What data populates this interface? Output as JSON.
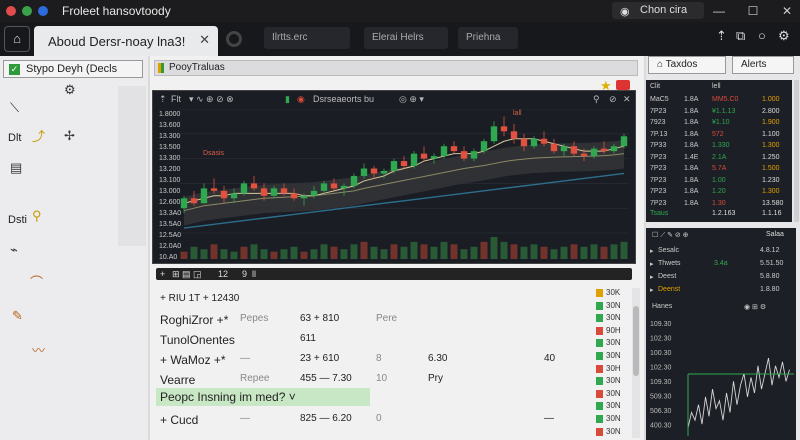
{
  "titlebar": {
    "title": "Froleet hansovtoody",
    "account": "Chon cira",
    "dot_colors": [
      "#e04b4b",
      "#3aa14a",
      "#2d6cdf"
    ]
  },
  "tabbar": {
    "active_tab": "Aboud Dersr-noay lna3!",
    "pills": [
      "Ilrtts.erc",
      "Elerai Helrs",
      "Priehna"
    ]
  },
  "sidebar": {
    "header": "Stypo Deyh (Decls",
    "labels": [
      "Dlt",
      "Dsti"
    ]
  },
  "main": {
    "header": "PooyTraluas",
    "chart_toolbar": {
      "left": "Flt",
      "indicator": "Dsrseaeorts bu"
    },
    "bottom_bar": {
      "zoom": "12",
      "pages": "9"
    }
  },
  "chart_data": {
    "type": "candlestick",
    "title": "",
    "price_labels": [
      "1.8000",
      "13.600",
      "13.300",
      "13.500",
      "13.300",
      "13.200",
      "13.100",
      "13.000",
      "12.600",
      "13.3A0",
      "13.5A0",
      "12.5A0",
      "12.0A0",
      "10.A0"
    ],
    "annotations": [
      "Dsasis",
      "lall"
    ],
    "candles": [
      [
        11.4,
        11.9,
        11.2,
        11.8
      ],
      [
        11.8,
        12.1,
        11.5,
        11.6
      ],
      [
        11.6,
        12.4,
        11.6,
        12.2
      ],
      [
        12.2,
        12.6,
        12.0,
        12.1
      ],
      [
        12.1,
        12.3,
        11.6,
        11.8
      ],
      [
        11.8,
        12.2,
        11.6,
        12.0
      ],
      [
        12.0,
        12.5,
        11.9,
        12.4
      ],
      [
        12.4,
        12.7,
        12.1,
        12.2
      ],
      [
        12.2,
        12.4,
        11.7,
        11.9
      ],
      [
        11.9,
        12.3,
        11.8,
        12.2
      ],
      [
        12.2,
        12.4,
        11.9,
        12.0
      ],
      [
        12.0,
        12.2,
        11.7,
        11.8
      ],
      [
        11.8,
        12.0,
        11.5,
        11.9
      ],
      [
        11.9,
        12.3,
        11.8,
        12.1
      ],
      [
        12.1,
        12.5,
        12.0,
        12.4
      ],
      [
        12.4,
        12.6,
        12.1,
        12.2
      ],
      [
        12.2,
        12.4,
        11.9,
        12.3
      ],
      [
        12.3,
        12.8,
        12.2,
        12.7
      ],
      [
        12.7,
        13.2,
        12.6,
        13.0
      ],
      [
        13.0,
        13.1,
        12.6,
        12.8
      ],
      [
        12.8,
        13.0,
        12.6,
        12.9
      ],
      [
        12.9,
        13.4,
        12.8,
        13.3
      ],
      [
        13.3,
        13.5,
        13.0,
        13.1
      ],
      [
        13.1,
        13.7,
        13.0,
        13.6
      ],
      [
        13.6,
        13.9,
        13.3,
        13.4
      ],
      [
        13.4,
        13.6,
        13.2,
        13.5
      ],
      [
        13.5,
        14.0,
        13.4,
        13.9
      ],
      [
        13.9,
        14.1,
        13.6,
        13.7
      ],
      [
        13.7,
        13.9,
        13.3,
        13.4
      ],
      [
        13.4,
        13.8,
        13.3,
        13.7
      ],
      [
        13.7,
        14.2,
        13.6,
        14.1
      ],
      [
        14.1,
        14.9,
        14.0,
        14.7
      ],
      [
        14.7,
        15.1,
        14.3,
        14.5
      ],
      [
        14.5,
        14.8,
        14.0,
        14.2
      ],
      [
        14.2,
        14.4,
        13.7,
        13.9
      ],
      [
        13.9,
        14.3,
        13.8,
        14.2
      ],
      [
        14.2,
        14.5,
        13.9,
        14.0
      ],
      [
        14.0,
        14.2,
        13.6,
        13.7
      ],
      [
        13.7,
        14.0,
        13.5,
        13.9
      ],
      [
        13.9,
        14.1,
        13.5,
        13.6
      ],
      [
        13.6,
        13.8,
        13.3,
        13.5
      ],
      [
        13.5,
        13.9,
        13.4,
        13.8
      ],
      [
        13.8,
        14.1,
        13.6,
        13.7
      ],
      [
        13.7,
        14.0,
        13.6,
        13.9
      ],
      [
        13.9,
        14.4,
        13.8,
        14.3
      ]
    ],
    "ma_fast": [
      11.6,
      11.7,
      11.8,
      11.9,
      11.9,
      12.0,
      12.0,
      12.0,
      12.0,
      12.0,
      12.0,
      12.0,
      11.9,
      11.9,
      12.0,
      12.1,
      12.2,
      12.3,
      12.5,
      12.6,
      12.7,
      12.9,
      13.0,
      13.1,
      13.3,
      13.4,
      13.5,
      13.6,
      13.6,
      13.6,
      13.7,
      13.9,
      14.1,
      14.2,
      14.2,
      14.2,
      14.1,
      14.0,
      13.9,
      13.8,
      13.7,
      13.7,
      13.7,
      13.8,
      13.9
    ],
    "ma_slow": [
      11.3,
      11.4,
      11.5,
      11.55,
      11.6,
      11.65,
      11.7,
      11.75,
      11.8,
      11.82,
      11.84,
      11.86,
      11.88,
      11.9,
      11.95,
      12.0,
      12.05,
      12.1,
      12.2,
      12.28,
      12.36,
      12.44,
      12.52,
      12.6,
      12.68,
      12.76,
      12.84,
      12.92,
      13.0,
      13.06,
      13.12,
      13.2,
      13.28,
      13.34,
      13.38,
      13.42,
      13.44,
      13.46,
      13.47,
      13.48,
      13.49,
      13.5,
      13.52,
      13.55,
      13.6
    ],
    "trend_line": [
      10.6,
      10.65,
      10.7,
      10.75,
      10.8,
      10.85,
      10.9,
      10.95,
      11.0,
      11.05,
      11.1,
      11.15,
      11.2,
      11.25,
      11.3,
      11.35,
      11.4,
      11.45,
      11.5,
      11.55,
      11.6,
      11.65,
      11.7,
      11.75,
      11.8,
      11.85,
      11.9,
      11.95,
      12.0,
      12.05,
      12.1,
      12.15,
      12.2,
      12.25,
      12.3,
      12.35,
      12.4,
      12.45,
      12.5,
      12.55,
      12.6,
      12.65,
      12.7,
      12.75,
      12.8
    ],
    "volume": [
      3,
      5,
      4,
      6,
      4,
      3,
      5,
      6,
      4,
      3,
      4,
      5,
      3,
      4,
      6,
      5,
      4,
      6,
      7,
      5,
      4,
      6,
      5,
      7,
      6,
      5,
      7,
      6,
      4,
      5,
      7,
      9,
      7,
      6,
      5,
      6,
      5,
      4,
      5,
      6,
      5,
      6,
      5,
      6,
      7
    ],
    "ylim": [
      10.4,
      15.4
    ],
    "up_color": "#2fa84f",
    "down_color": "#e0523f"
  },
  "table": {
    "rows": [
      {
        "c1": "+ RIU 1T + 12430",
        "c2": "",
        "c3": "",
        "c4": "",
        "c5": "",
        "c6": ""
      },
      {
        "c1": "RoghiZror +*",
        "c2": "Pepes",
        "c3": "63 + 810",
        "c4": "Pere",
        "c5": "",
        "c6": ""
      },
      {
        "c1": "TunolOnentes",
        "c2": "",
        "c3": "611",
        "c4": "",
        "c5": "",
        "c6": ""
      },
      {
        "c1": "+ WaMoz +*",
        "c2": "—",
        "c3": "23 + 610",
        "c4": "8",
        "c5": "6.30",
        "c6": "40"
      },
      {
        "c1": "Vearre",
        "c2": "Repee",
        "c3": "455 — 7.30",
        "c4": "10",
        "c5": "Pry",
        "c6": ""
      },
      {
        "c1": "",
        "c2": "",
        "c3": "",
        "c4": "",
        "c5": "",
        "c6": ""
      },
      {
        "c1": "+ Cucd",
        "c2": "—",
        "c3": "825 — 6.20",
        "c4": "0",
        "c5": "",
        "c6": "—"
      }
    ],
    "people_row": "Peopc Insning im med? ˅",
    "badges": [
      "30K",
      "30N",
      "30N",
      "90H",
      "30N",
      "30N",
      "30H",
      "30N",
      "30N",
      "30N",
      "30N",
      "30N"
    ]
  },
  "rpanel": {
    "tabs": [
      "Taxdos",
      "Alerts"
    ],
    "orderbook": {
      "header": [
        "Clit",
        "",
        "lell",
        ""
      ],
      "rows": [
        [
          "MaC5",
          "1.8A",
          "MM5.C0",
          "1.000"
        ],
        [
          "7P23",
          "1.8A",
          "¥1.1.13",
          "2.800"
        ],
        [
          "7923",
          "1.8A",
          "¥1.10",
          "1.900"
        ],
        [
          "7P.13",
          "1.8A",
          "572",
          "1.100"
        ],
        [
          "7P33",
          "1.8A",
          "1.330",
          "1.300"
        ],
        [
          "7P23",
          "1.4E",
          "2.1A",
          "1.250"
        ],
        [
          "7P23",
          "1.8A",
          "5.7A",
          "1.500"
        ],
        [
          "7P23",
          "1.8A",
          "1.00",
          "1.230"
        ],
        [
          "7P23",
          "1.8A",
          "1.20",
          "1.300"
        ],
        [
          "7P23",
          "1.8A",
          "1.30",
          "13.580"
        ]
      ],
      "footer": [
        "Tsaus",
        "1.2.163",
        "1.1.16"
      ]
    },
    "watch": {
      "head": "Salaa",
      "rows": [
        [
          "Sesalc",
          "",
          "4.8.12"
        ],
        [
          "Thwets",
          "3.4a",
          "5.51.50"
        ],
        [
          "Deest",
          "",
          "5.8.80"
        ],
        [
          "Deenst",
          "",
          "1.8.80"
        ]
      ],
      "sub_label": "Hanes",
      "mini_labels": [
        "109.30",
        "102.30",
        "100.30",
        "102.30",
        "109.30",
        "509.30",
        "506.30",
        "400.30"
      ],
      "mini_series": [
        10,
        14,
        12,
        16,
        11,
        18,
        13,
        20,
        15,
        17,
        12,
        19,
        14,
        22,
        16,
        21,
        24,
        18,
        23,
        19,
        26,
        20,
        24,
        28,
        21,
        26,
        23,
        27,
        22,
        25
      ],
      "green_line": "#2fa84f"
    }
  }
}
